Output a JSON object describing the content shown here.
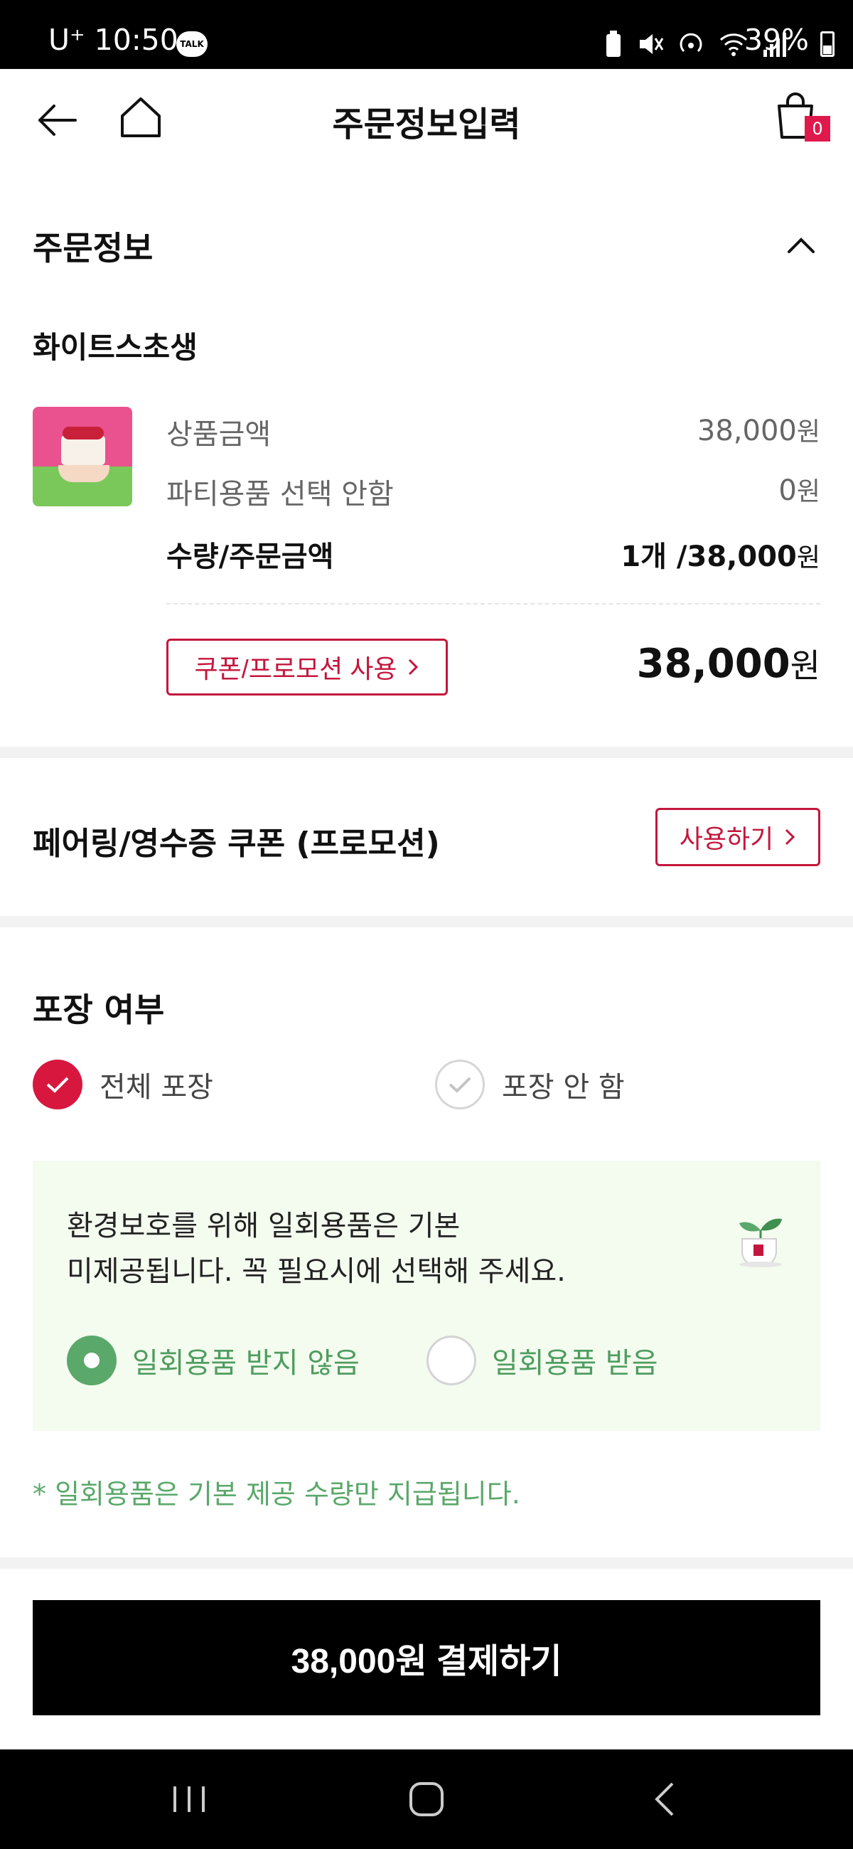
{
  "status_bar": {
    "carrier_time": "U⁺ 10:50",
    "talk_label": "TALK",
    "battery": "39%"
  },
  "header": {
    "title": "주문정보입력",
    "cart_count": "0"
  },
  "order_info": {
    "section_title": "주문정보",
    "product_name": "화이트스초생",
    "rows": [
      {
        "label": "상품금액",
        "value": "38,000",
        "unit": "원"
      },
      {
        "label": "파티용품 선택 안함",
        "value": "0",
        "unit": "원"
      },
      {
        "label": "수량/주문금액",
        "value": "1개 /38,000",
        "unit": "원"
      }
    ],
    "coupon_button": "쿠폰/프로모션 사용",
    "total_value": "38,000",
    "total_unit": "원"
  },
  "pairing": {
    "title": "페어링/영수증 쿠폰 (프로모션)",
    "use_button": "사용하기"
  },
  "packaging": {
    "title": "포장 여부",
    "option_all": "전체 포장",
    "option_none": "포장 안 함",
    "selected": "전체 포장"
  },
  "eco": {
    "line1": "환경보호를 위해 일회용품은 기본",
    "line2": "미제공됩니다. 꼭 필요시에 선택해 주세요.",
    "option_decline": "일회용품 받지 않음",
    "option_accept": "일회용품 받음",
    "selected": "일회용품 받지 않음",
    "note": "* 일회용품은 기본 제공 수량만 지급됩니다."
  },
  "pay_button": "38,000원 결제하기",
  "colors": {
    "accent_red": "#d8173f",
    "eco_green": "#5aa86a",
    "eco_bg": "#f4fbef"
  },
  "icons": [
    "back-arrow-icon",
    "home-icon",
    "cart-icon",
    "chevron-up-icon",
    "check-icon",
    "eco-cup-icon",
    "nav-recents-icon",
    "nav-home-icon",
    "nav-back-icon"
  ]
}
